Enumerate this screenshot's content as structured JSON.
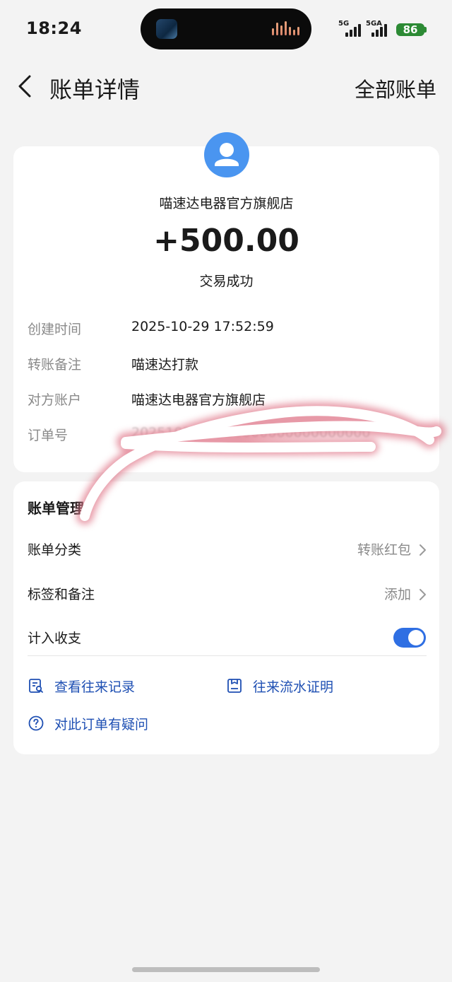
{
  "status_bar": {
    "time": "18:24",
    "network_1": "5G",
    "network_2": "5GA",
    "battery": "86"
  },
  "header": {
    "title": "账单详情",
    "right_link": "全部账单",
    "back_icon": "chevron-left-icon"
  },
  "detail": {
    "avatar_icon": "user-avatar-icon",
    "merchant": "喵速达电器官方旗舰店",
    "amount": "+500.00",
    "status": "交易成功",
    "rows": [
      {
        "label": "创建时间",
        "value": "2025-10-29 17:52:59"
      },
      {
        "label": "转账备注",
        "value": "喵速达打款"
      },
      {
        "label": "对方账户",
        "value": "喵速达电器官方旗舰店"
      },
      {
        "label": "订单号",
        "value": "2025102900000000000000000000"
      }
    ]
  },
  "manage": {
    "title": "账单管理",
    "rows": [
      {
        "label": "账单分类",
        "value": "转账红包"
      },
      {
        "label": "标签和备注",
        "value": "添加"
      },
      {
        "label": "计入收支",
        "toggle_on": true
      }
    ],
    "actions": [
      {
        "label": "查看往来记录",
        "icon": "record-search-icon"
      },
      {
        "label": "往来流水证明",
        "icon": "statement-icon"
      },
      {
        "label": "对此订单有疑问",
        "icon": "question-circle-icon"
      }
    ]
  },
  "colors": {
    "background": "#f3f3f3",
    "card": "#ffffff",
    "accent_blue": "#1e4fb3",
    "toggle_on": "#2f6fe3",
    "avatar": "#4a95f0",
    "battery": "#2c8a34"
  }
}
